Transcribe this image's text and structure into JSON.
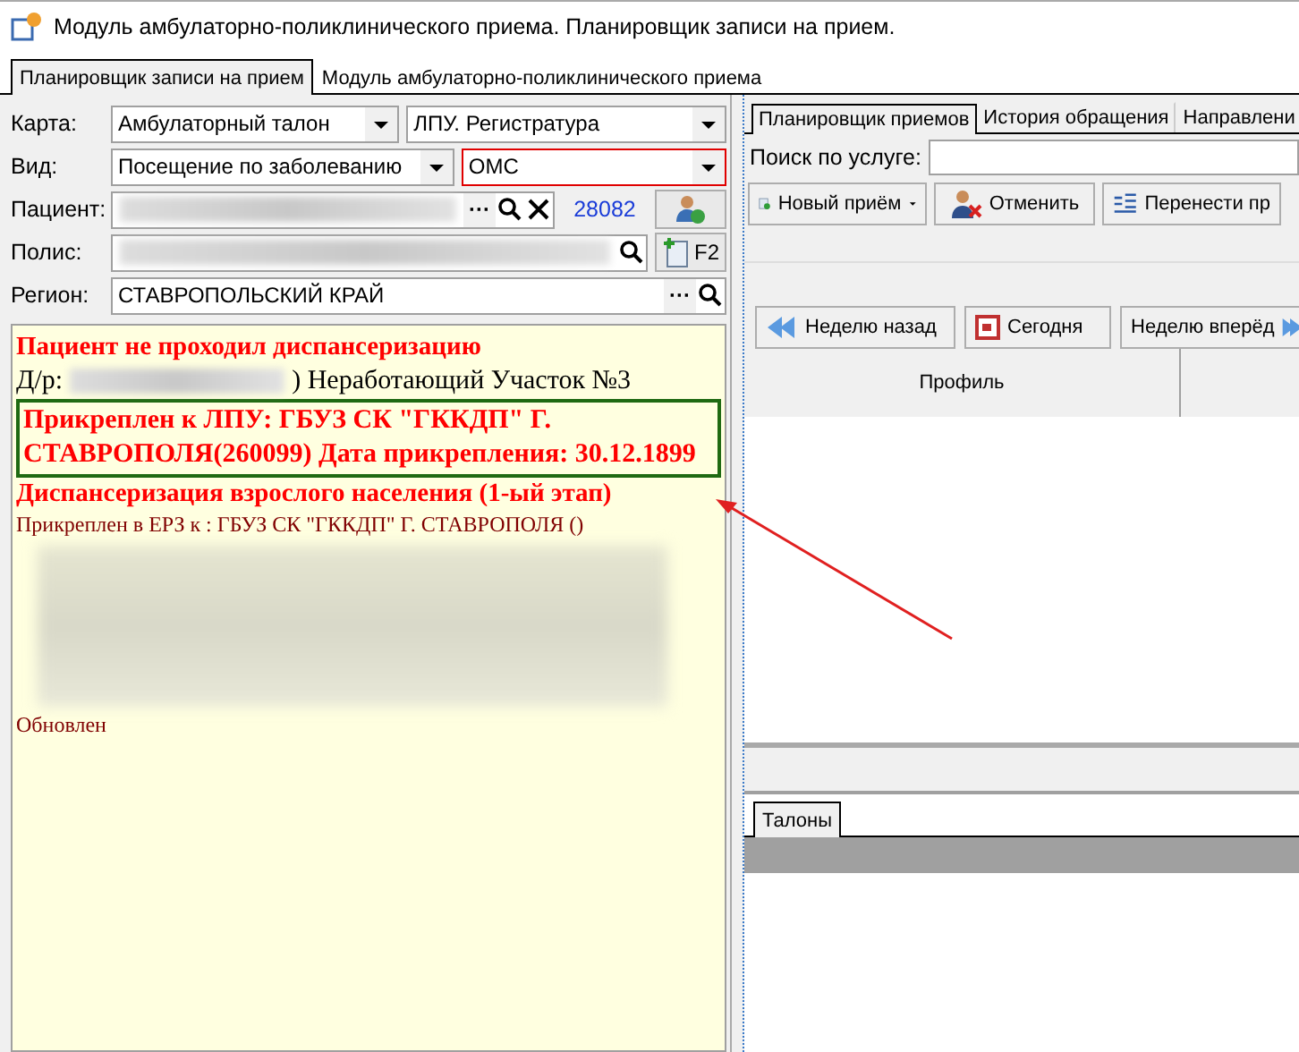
{
  "window": {
    "title": "Модуль амбулаторно-поликлинического приема. Планировщик записи на прием."
  },
  "tabs": [
    {
      "label": "Планировщик записи на прием",
      "selected": true
    },
    {
      "label": "Модуль амбулаторно-поликлинического приема",
      "selected": false
    }
  ],
  "form": {
    "rows": [
      {
        "kind": "combos",
        "label": "Карта:",
        "fields": [
          {
            "value": "Амбулаторный талон",
            "invalid": false
          },
          {
            "value": "ЛПУ. Регистратура",
            "invalid": false
          }
        ]
      },
      {
        "kind": "combos",
        "label": "Вид:",
        "fields": [
          {
            "value": "Посещение по заболеванию",
            "invalid": false
          },
          {
            "value": "ОМС",
            "invalid": true
          }
        ]
      },
      {
        "kind": "patient",
        "label": "Пациент:",
        "more": "···",
        "number": "28082"
      },
      {
        "kind": "polis",
        "label": "Полис:",
        "button": "F2"
      },
      {
        "kind": "region",
        "label": "Регион:",
        "value": "СТАВРОПОЛЬСКИЙ КРАЙ",
        "more": "···"
      }
    ]
  },
  "info": [
    {
      "kind": "heading",
      "text": "Пациент не проходил диспансеризацию"
    },
    {
      "kind": "dob",
      "prefix": "Д/р:",
      "suffix": ") Неработающий Участок №3"
    },
    {
      "kind": "boxed",
      "text": "Прикреплен к ЛПУ: ГБУЗ СК \"ГККДП\" Г. СТАВРОПОЛЯ(260099) Дата прикрепления: 30.12.1899"
    },
    {
      "kind": "heading",
      "text": "Диспансеризация взрослого населения (1-ый этап)"
    },
    {
      "kind": "text",
      "text": "Прикреплен в ЕРЗ к : ГБУЗ СК \"ГККДП\" Г. СТАВРОПОЛЯ ()"
    },
    {
      "kind": "redacted"
    },
    {
      "kind": "text",
      "text": "Обновлен"
    }
  ],
  "right": {
    "tabs": [
      {
        "label": "Планировщик приемов",
        "selected": true
      },
      {
        "label": "История обращения",
        "selected": false
      },
      {
        "label": "Направлени",
        "selected": false
      }
    ],
    "search_label": "Поиск по услуге:",
    "toolbar": [
      {
        "kind": "new",
        "label": "Новый приём"
      },
      {
        "kind": "cancel",
        "label": "Отменить"
      },
      {
        "kind": "move",
        "label": "Перенести пр"
      }
    ],
    "nav": [
      {
        "kind": "back",
        "label": "Неделю назад"
      },
      {
        "kind": "today",
        "label": "Сегодня"
      },
      {
        "kind": "forward",
        "label": "Неделю вперёд"
      }
    ],
    "table": {
      "columns": [
        "Профиль"
      ]
    },
    "bottom_tabs": [
      {
        "label": "Талоны",
        "selected": true
      }
    ]
  }
}
